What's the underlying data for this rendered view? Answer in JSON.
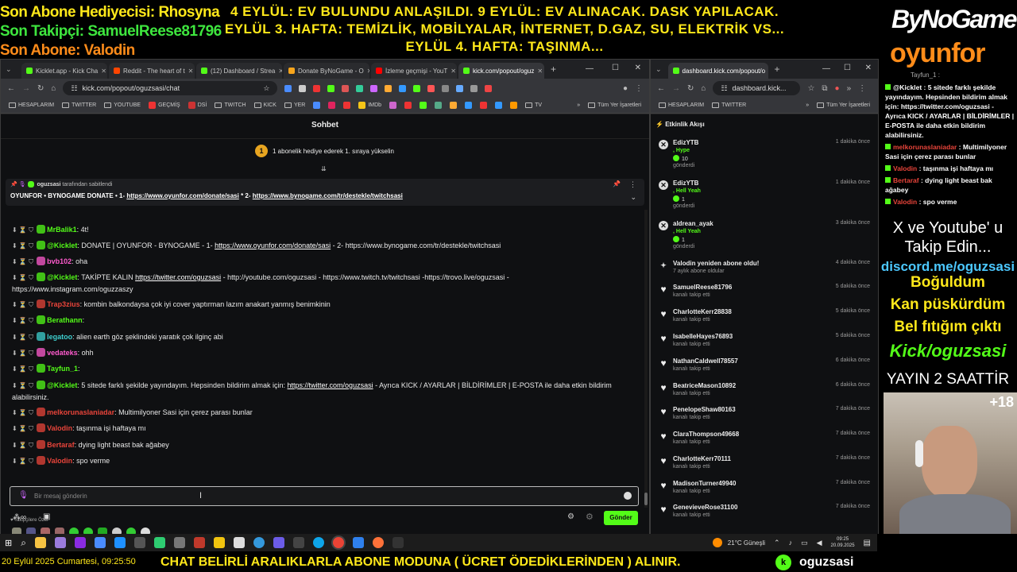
{
  "overlay": {
    "gift_label": "Son Abone Hediyecisi: Rhosyna",
    "follower_label": "Son Takipçi: SamuelReese81796",
    "sub_label": "Son Abone: Valodin",
    "announce_lines": [
      "4 EYLÜL: EV BULUNDU ANLAŞILDI. 9 EYLÜL: EV ALINACAK. DASK YAPILACAK.",
      "EYLÜL 3. HAFTA: TEMİZLİK, MOBİLYALAR, İNTERNET, D.GAZ, SU, ELEKTRİK VS...",
      "EYLÜL 4. HAFTA: TAŞINMA..."
    ]
  },
  "browser_left": {
    "tabs": [
      {
        "label": "Kicklet.app - Kick Cha",
        "color": "#53fc18"
      },
      {
        "label": "Reddit - The heart of t",
        "color": "#ff4500"
      },
      {
        "label": "(12) Dashboard / Strea",
        "color": "#53fc18"
      },
      {
        "label": "Donate ByNoGame - O",
        "color": "#f7a51c"
      },
      {
        "label": "İzleme geçmişi - YouT",
        "color": "#ff0000"
      },
      {
        "label": "kick.com/popout/oguz",
        "color": "#53fc18"
      }
    ],
    "url": "kick.com/popout/oguzsasi/chat",
    "bookmarks": [
      "HESAPLARIM",
      "TWITTER",
      "YOUTUBE",
      "GEÇMİŞ",
      "DSİ",
      "TWITCH",
      "KICK",
      "YER",
      "IMDb",
      "TV"
    ],
    "bookmarks_all": "Tüm Yer İşaretleri"
  },
  "chat": {
    "title": "Sohbet",
    "gift_banner": "1 abonelik hediye ederek 1. sıraya yükselin",
    "gift_rank": "1",
    "pinned_by_user": "oguzsasi",
    "pinned_by_suffix": "tarafından sabitlendi",
    "pinned_text": "OYUNFOR • BYNOGAME DONATE • 1- ",
    "pinned_link1": "https://www.oyunfor.com/donate/sasi",
    "pinned_mid": " * 2- ",
    "pinned_link2": "https://www.bynogame.com/tr/destekle/twitchsasi",
    "messages": [
      {
        "user": "MrBalik1",
        "color": "#53fc18",
        "text": ": 4t!",
        "link": "",
        "tail": ""
      },
      {
        "user": "@Kicklet",
        "color": "#53fc18",
        "text": ": DONATE | OYUNFOR - BYNOGAME - 1- ",
        "link": "https://www.oyunfor.com/donate/sasi",
        "tail": " - 2- https://www.bynogame.com/tr/destekle/twitchsasi"
      },
      {
        "user": "bvb102",
        "color": "#ff5bce",
        "text": ": oha",
        "link": "",
        "tail": ""
      },
      {
        "user": "@Kicklet",
        "color": "#53fc18",
        "text": ": TAKİPTE KALIN ",
        "link": "https://twitter.com/oguzsasi",
        "tail": " - http://youtube.com/oguzsasi - https://www.twitch.tv/twitchsasi -https://trovo.live/oguzsasi - https://www.instagram.com/oguzzaszy"
      },
      {
        "user": "Trap3zius",
        "color": "#e8443a",
        "text": ": kombin balkondaysa çok iyi cover yaptırman lazım anakart yanmış benimkinin",
        "link": "",
        "tail": ""
      },
      {
        "user": "Berathann",
        "color": "#53fc18",
        "text": ":",
        "link": "",
        "tail": ""
      },
      {
        "user": "legatoo",
        "color": "#3ecfcf",
        "text": ": alien earth göz şeklindeki yaratık çok ilginç abi",
        "link": "",
        "tail": ""
      },
      {
        "user": "vedateks",
        "color": "#ff5bce",
        "text": ": ohh",
        "link": "",
        "tail": ""
      },
      {
        "user": "Tayfun_1",
        "color": "#53fc18",
        "text": ":",
        "link": "",
        "tail": ""
      },
      {
        "user": "@Kicklet",
        "color": "#53fc18",
        "text": ": 5 sitede farklı şekilde yayındayım. Hepsinden bildirim almak için: ",
        "link": "https://twitter.com/oguzsasi",
        "tail": " - Ayrıca KICK / AYARLAR | BİLDİRİMLER | E-POSTA ile daha etkin bildirim alabilirsiniz."
      },
      {
        "user": "melkorunaslaniadar",
        "color": "#e8443a",
        "text": ": Multimilyoner Sasi için çerez parası bunlar",
        "link": "",
        "tail": ""
      },
      {
        "user": "Valodin",
        "color": "#e8443a",
        "text": ": taşınma işi haftaya mı",
        "link": "",
        "tail": ""
      },
      {
        "user": "Bertaraf",
        "color": "#e8443a",
        "text": ": dying light beast bak ağabey",
        "link": "",
        "tail": ""
      },
      {
        "user": "Valodin",
        "color": "#e8443a",
        "text": ": spo verme",
        "link": "",
        "tail": ""
      }
    ],
    "emote_label": "Takipçilere Özel",
    "input_placeholder": "Bir mesaj gönderin",
    "send_label": "Gönder"
  },
  "browser_right": {
    "tab_label": "dashboard.kick.com/popout/o",
    "url": "dashboard.kick...",
    "bookmarks": [
      "HESAPLARIM",
      "TWITTER"
    ],
    "bookmarks_all": "Tüm Yer İşaretleri"
  },
  "activity": {
    "title": "Etkinlik Akışı",
    "items": [
      {
        "name": "EdizYTB",
        "line1": ", Hype",
        "line2": "10",
        "line3": "gönderdi",
        "time": "1 dakika önce",
        "icon": "kick-icon"
      },
      {
        "name": "EdizYTB",
        "line1": ", Hell Yeah",
        "line2": "1",
        "line3": "gönderdi",
        "time": "1 dakika önce",
        "icon": "kick-icon"
      },
      {
        "name": "aldrean_ayak",
        "line1": ", Hell Yeah",
        "line2": "1",
        "line3": "gönderdi",
        "time": "3 dakika önce",
        "icon": "kick-icon"
      },
      {
        "name": "Valodin yeniden abone oldu!",
        "line1": "7 aylık abone oldular",
        "line2": "",
        "line3": "",
        "time": "4 dakika önce",
        "icon": "star-icon"
      },
      {
        "name": "SamuelReese81796",
        "line1": "kanalı takip etti",
        "time": "5 dakika önce",
        "icon": "heart-icon"
      },
      {
        "name": "CharlotteKerr28838",
        "line1": "kanalı takip etti",
        "time": "5 dakika önce",
        "icon": "heart-icon"
      },
      {
        "name": "IsabelleHayes76893",
        "line1": "kanalı takip etti",
        "time": "5 dakika önce",
        "icon": "heart-icon"
      },
      {
        "name": "NathanCaldwell78557",
        "line1": "kanalı takip etti",
        "time": "6 dakika önce",
        "icon": "heart-icon"
      },
      {
        "name": "BeatriceMason10892",
        "line1": "kanalı takip etti",
        "time": "6 dakika önce",
        "icon": "heart-icon"
      },
      {
        "name": "PenelopeShaw80163",
        "line1": "kanalı takip etti",
        "time": "7 dakika önce",
        "icon": "heart-icon"
      },
      {
        "name": "ClaraThompson49668",
        "line1": "kanalı takip etti",
        "time": "7 dakika önce",
        "icon": "heart-icon"
      },
      {
        "name": "CharlotteKerr70111",
        "line1": "kanalı takip etti",
        "time": "7 dakika önce",
        "icon": "heart-icon"
      },
      {
        "name": "MadisonTurner49940",
        "line1": "kanalı takip etti",
        "time": "7 dakika önce",
        "icon": "heart-icon"
      },
      {
        "name": "GenevieveRose31100",
        "line1": "kanalı takip etti",
        "time": "7 dakika önce",
        "icon": "heart-icon"
      }
    ]
  },
  "right_overlay": {
    "logo_top": "ByNoGame",
    "logo_bottom": "oyunfor",
    "chat_top": "Tayfun_1 :",
    "chat_lines": [
      {
        "user": "@Kicklet",
        "color": "#ffffff",
        "text": " : 5 sitede farklı şekilde yayındayım. Hepsinden bildirim almak için: https://twitter.com/oguzsasi - Ayrıca KICK / AYARLAR | BİLDİRİMLER | E-POSTA ile daha etkin bildirim alabilirsiniz."
      },
      {
        "user": "melkorunaslaniadar",
        "color": "#e8443a",
        "text": " : Multimilyoner Sasi için çerez parası bunlar"
      },
      {
        "user": "Valodin",
        "color": "#e8443a",
        "text": " : taşınma işi haftaya mı"
      },
      {
        "user": "Bertaraf",
        "color": "#e8443a",
        "text": " : dying light beast bak ağabey"
      },
      {
        "user": "Valodin",
        "color": "#e8443a",
        "text": " : spo verme"
      }
    ],
    "promo1": "X ve Youtube' u",
    "promo2": "Takip Edin...",
    "discord": "discord.me/oguzsasi",
    "line_a": "Boğuldum",
    "line_b": "Kan püskürdüm",
    "line_c": "Bel fıtığım çıktı",
    "kick": "Kick/oguzsasi",
    "uptime": "YAYIN 2 SAATTİR",
    "age": "+18"
  },
  "taskbar": {
    "weather": "21°C  Güneşli",
    "time": "09:25",
    "date": "20.09.2025"
  },
  "bottom": {
    "datetime": "20 Eylül 2025 Cumartesi, 09:25:50",
    "ticker": "CHAT BELİRLİ ARALIKLARLA ABONE MODUNA ( ÜCRET ÖDEDİKLERİNDEN ) ALINIR.",
    "channel": "oguzsasi"
  }
}
